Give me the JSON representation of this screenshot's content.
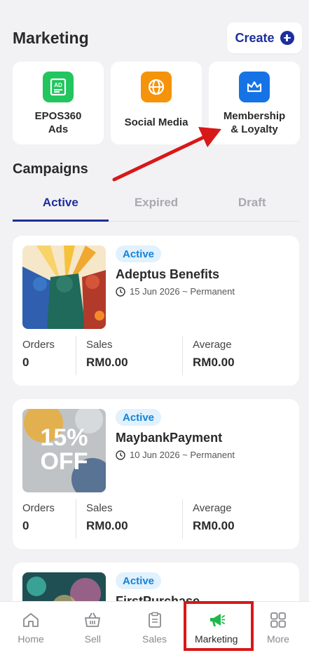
{
  "header": {
    "title": "Marketing",
    "create_label": "Create"
  },
  "tiles": [
    {
      "label": "EPOS360\nAds",
      "icon": "ad-icon",
      "color": "#22c55e"
    },
    {
      "label": "Social Media",
      "icon": "globe-icon",
      "color": "#f5930b"
    },
    {
      "label": "Membership\n& Loyalty",
      "icon": "crown-icon",
      "color": "#1673e6"
    }
  ],
  "campaigns": {
    "title": "Campaigns",
    "tabs": [
      "Active",
      "Expired",
      "Draft"
    ],
    "items": [
      {
        "status": "Active",
        "name": "Adeptus Benefits",
        "date": "15 Jun 2026 ~ Permanent",
        "orders_label": "Orders",
        "orders": "0",
        "sales_label": "Sales",
        "sales": "RM0.00",
        "average_label": "Average",
        "average": "RM0.00"
      },
      {
        "status": "Active",
        "name": "MaybankPayment",
        "date": "10 Jun 2026 ~ Permanent",
        "thumb_text": "15%\nOFF",
        "orders_label": "Orders",
        "orders": "0",
        "sales_label": "Sales",
        "sales": "RM0.00",
        "average_label": "Average",
        "average": "RM0.00"
      },
      {
        "status": "Active",
        "name": "FirstPurchase"
      }
    ]
  },
  "nav": [
    {
      "label": "Home",
      "icon": "home-icon"
    },
    {
      "label": "Sell",
      "icon": "basket-icon"
    },
    {
      "label": "Sales",
      "icon": "clipboard-icon"
    },
    {
      "label": "Marketing",
      "icon": "megaphone-icon",
      "active": true
    },
    {
      "label": "More",
      "icon": "grid-icon"
    }
  ],
  "colors": {
    "primary": "#1d2f9c",
    "annotation": "#d81818"
  }
}
